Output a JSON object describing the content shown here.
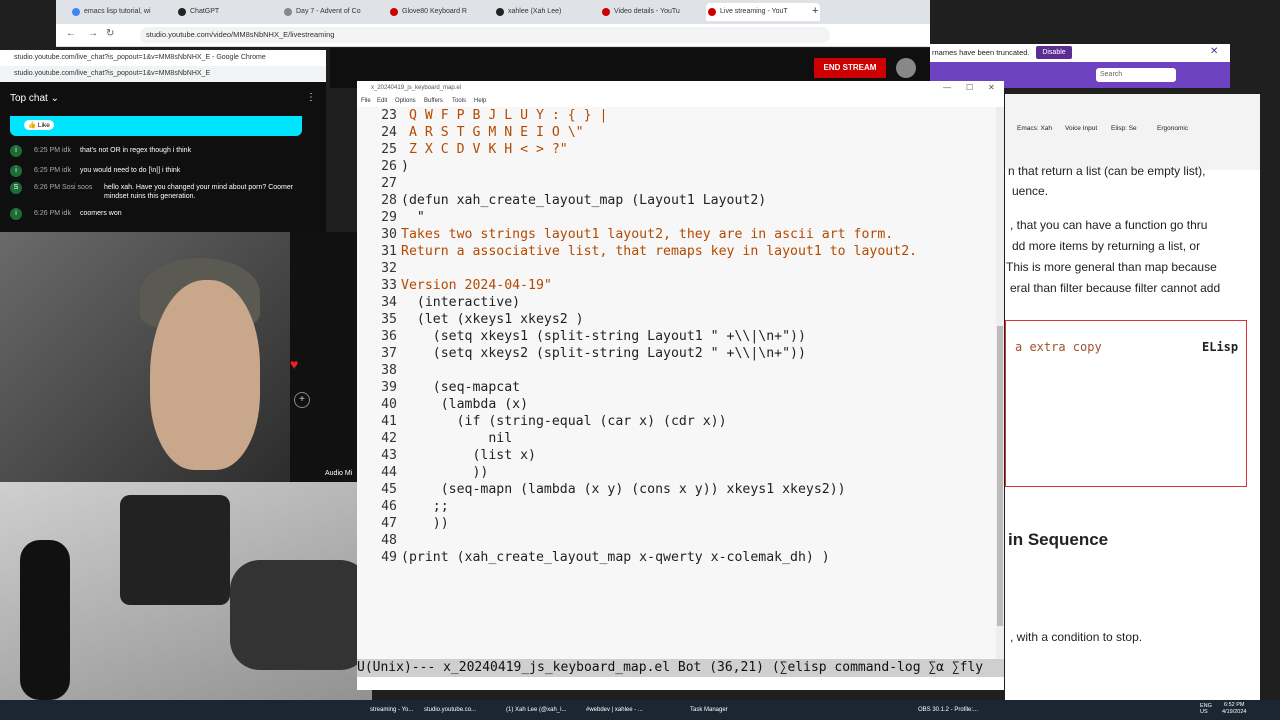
{
  "chrome": {
    "tabs": [
      {
        "label": "emacs lisp tutorial, wi",
        "color": "#4285f4"
      },
      {
        "label": "ChatGPT",
        "color": "#222222"
      },
      {
        "label": "Day 7 - Advent of Co",
        "color": "#888888"
      },
      {
        "label": "Glove80 Keyboard R",
        "color": "#cc0000"
      },
      {
        "label": "xahlee (Xah Lee)",
        "color": "#222222"
      },
      {
        "label": "Video details - YouTu",
        "color": "#cc0000"
      },
      {
        "label": "Live streaming - YouT",
        "color": "#cc0000"
      }
    ],
    "new_tab": "+",
    "address": "studio.youtube.com/video/MM8sNbNHX_E/livestreaming",
    "end_stream": "END STREAM"
  },
  "chat_window": {
    "title": "studio.youtube.com/live_chat?is_popout=1&v=MM8sNbNHX_E - Google Chrome",
    "url": "studio.youtube.com/live_chat?is_popout=1&v=MM8sNbNHX_E",
    "header": "Top chat",
    "like": "Like",
    "messages": [
      {
        "avatar": "i",
        "time": "6:25 PM",
        "name": "idk",
        "text": "that's not OR in regex though i think"
      },
      {
        "avatar": "i",
        "time": "6:25 PM",
        "name": "idk",
        "text": "you would need to do [\\n|] i think"
      },
      {
        "avatar": "S",
        "time": "6:26 PM",
        "name": "Sosi soos",
        "text": "hello xah. Have you changed your mind about porn? Coomer mindset ruins this generation."
      },
      {
        "avatar": "i",
        "time": "6:26 PM",
        "name": "idk",
        "text": "coomers won"
      }
    ]
  },
  "behind": {
    "audio_label": "Audio Mi"
  },
  "right_browser": {
    "notice": "rnames have been truncated.",
    "disable": "Disable",
    "search": "Search",
    "tabs": [
      "Emacs: Xah",
      "Voice Input",
      "Elisp: Se",
      "Ergonomic"
    ],
    "lines": [
      "n that return a list (can be empty list),",
      "uence.",
      ", that you can have a function go thru",
      "dd more items by returning a list, or",
      "This is more general than map because",
      "eral than filter because filter cannot add"
    ],
    "box_text": "a extra copy",
    "box_label": "ELisp",
    "heading": "in Sequence",
    "bottom_line": ", with a condition to stop."
  },
  "emacs": {
    "title": "x_20240419_js_keyboard_map.el",
    "menu": [
      "File",
      "Edit",
      "Options",
      "Buffers",
      "Tools",
      "Help"
    ],
    "lines": [
      {
        "n": "23",
        "t": " Q W F P B J L U Y : { } |"
      },
      {
        "n": "24",
        "t": " A R S T G M N E I O \\\""
      },
      {
        "n": "25",
        "t": " Z X C D V K H < > ?\""
      },
      {
        "n": "26",
        "t": ")"
      },
      {
        "n": "27",
        "t": ""
      },
      {
        "n": "28",
        "t": "(defun xah_create_layout_map (Layout1 Layout2)"
      },
      {
        "n": "29",
        "t": "  \""
      },
      {
        "n": "30",
        "t": "Takes two strings layout1 layout2, they are in ascii art form."
      },
      {
        "n": "31",
        "t": "Return a associative list, that remaps key in layout1 to layout2."
      },
      {
        "n": "32",
        "t": ""
      },
      {
        "n": "33",
        "t": "Version 2024-04-19\""
      },
      {
        "n": "34",
        "t": "  (interactive)"
      },
      {
        "n": "35",
        "t": "  (let (xkeys1 xkeys2 )"
      },
      {
        "n": "36",
        "t": "    (setq xkeys1 (split-string Layout1 \" +\\\\|\\n+\"))"
      },
      {
        "n": "37",
        "t": "    (setq xkeys2 (split-string Layout2 \" +\\\\|\\n+\"))"
      },
      {
        "n": "38",
        "t": ""
      },
      {
        "n": "39",
        "t": "    (seq-mapcat"
      },
      {
        "n": "40",
        "t": "     (lambda (x)"
      },
      {
        "n": "41",
        "t": "       (if (string-equal (car x) (cdr x))"
      },
      {
        "n": "42",
        "t": "           nil"
      },
      {
        "n": "43",
        "t": "         (list x)"
      },
      {
        "n": "44",
        "t": "         ))"
      },
      {
        "n": "45",
        "t": "     (seq-mapn (lambda (x y) (cons x y)) xkeys1 xkeys2))"
      },
      {
        "n": "46",
        "t": "    ;;"
      },
      {
        "n": "47",
        "t": "    ))"
      },
      {
        "n": "48",
        "t": ""
      },
      {
        "n": "49",
        "t": "(print (xah_create_layout_map x-qwerty x-colemak_dh) )"
      }
    ],
    "modeline": "U(Unix)--- x_20240419_js_keyboard_map.el Bot (36,21) (∑elisp command-log ∑α ∑fly",
    "highlight_color": "#b8f0a8"
  },
  "taskbar": {
    "items": [
      "streaming - Yo...",
      "studio.youtube.co...",
      "(1) Xah Lee (@xah_l...",
      "#webdev | xahlee - ...",
      "Task Manager",
      "OBS 30.1.2 - Profile:..."
    ],
    "lang": "ENG US",
    "time": "6:52 PM",
    "date": "4/19/2024"
  }
}
